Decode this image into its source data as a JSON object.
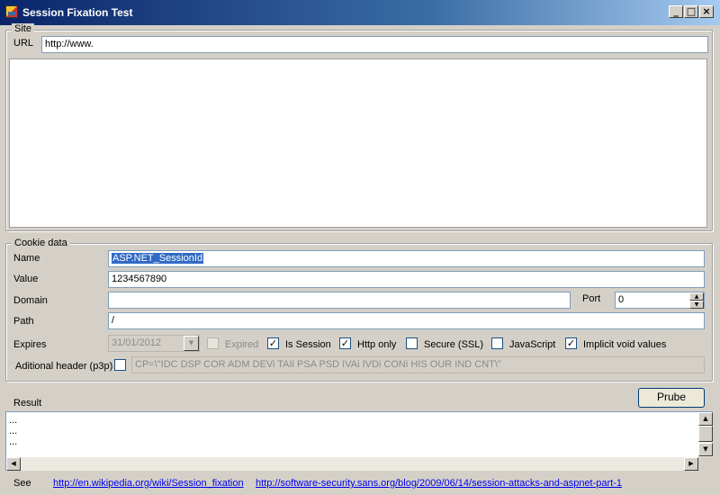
{
  "window": {
    "title": "Session Fixation Test",
    "minimize": "_",
    "maximize": "□",
    "close": "×"
  },
  "site": {
    "group_label": "Site",
    "url_label": "URL",
    "url_value": "http://www."
  },
  "cookie": {
    "group_label": "Cookie data",
    "name_label": "Name",
    "name_value": "ASP.NET_SessionId",
    "value_label": "Value",
    "value_value": "1234567890",
    "domain_label": "Domain",
    "domain_value": "",
    "port_label": "Port",
    "port_value": "0",
    "path_label": "Path",
    "path_value": "/",
    "expires_label": "Expires",
    "expires_value": "31/01/2012",
    "expired_label": "Expired",
    "is_session_label": "Is Session",
    "http_only_label": "Http only",
    "secure_label": "Secure (SSL)",
    "javascript_label": "JavaScript",
    "implicit_void_label": "Implicit void values",
    "p3p_label": "Aditional header (p3p)",
    "p3p_value": "CP=\\\"IDC DSP COR ADM DEVi TAIi PSA PSD IVAi IVDi CONi HIS OUR IND CNT\\\"",
    "check_mark": "✓"
  },
  "result": {
    "label": "Result",
    "button_label": "Prube",
    "lines": [
      "...",
      "...",
      "..."
    ]
  },
  "footer": {
    "see_label": "See",
    "link1": "http://en.wikipedia.org/wiki/Session_fixation",
    "link2": "http://software-security.sans.org/blog/2009/06/14/session-attacks-and-aspnet-part-1"
  },
  "icons": {
    "dropdown": "▼",
    "spin_up": "▲",
    "spin_down": "▼",
    "scroll_up": "▲",
    "scroll_down": "▼",
    "scroll_left": "◀",
    "scroll_right": "▶"
  }
}
